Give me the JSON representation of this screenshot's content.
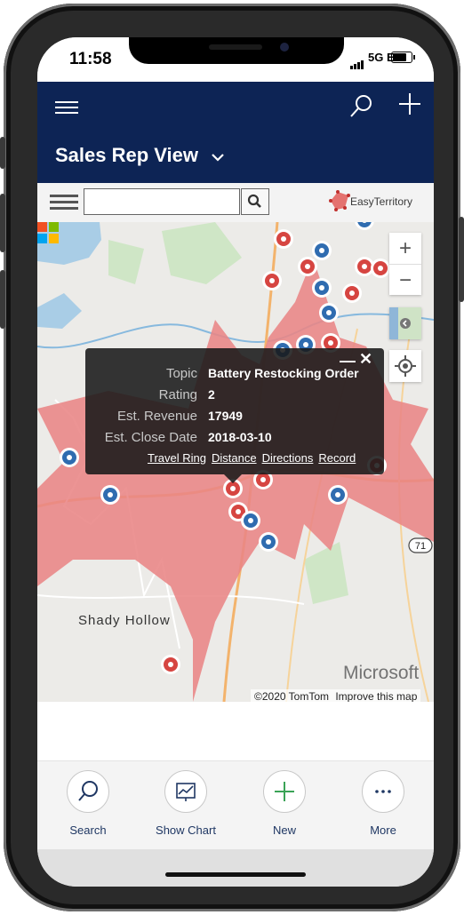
{
  "status": {
    "time": "11:58",
    "network": "5G E"
  },
  "appbar": {
    "title": "Sales Rep View"
  },
  "toolbar": {
    "search_value": "",
    "brand": "EasyTerritory"
  },
  "map": {
    "place_label": "Shady Hollow",
    "route_shield": "71",
    "microsoft": "Microsoft",
    "copyright": "©2020 TomTom",
    "improve_link": "Improve this map"
  },
  "popup": {
    "fields": [
      {
        "label": "Topic",
        "value": "Battery Restocking Order"
      },
      {
        "label": "Rating",
        "value": "2"
      },
      {
        "label": "Est. Revenue",
        "value": "17949"
      },
      {
        "label": "Est. Close Date",
        "value": "2018-03-10"
      }
    ],
    "links": [
      "Travel Ring",
      "Distance",
      "Directions",
      "Record"
    ]
  },
  "footer": {
    "buttons": [
      {
        "label": "Search",
        "icon": "search-icon"
      },
      {
        "label": "Show Chart",
        "icon": "chart-icon"
      },
      {
        "label": "New",
        "icon": "plus-icon"
      },
      {
        "label": "More",
        "icon": "ellipsis-icon"
      }
    ]
  },
  "colors": {
    "header": "#0d2455",
    "territory": "#e98585",
    "pin_red": "#d64541",
    "pin_blue": "#2f6cb0"
  }
}
